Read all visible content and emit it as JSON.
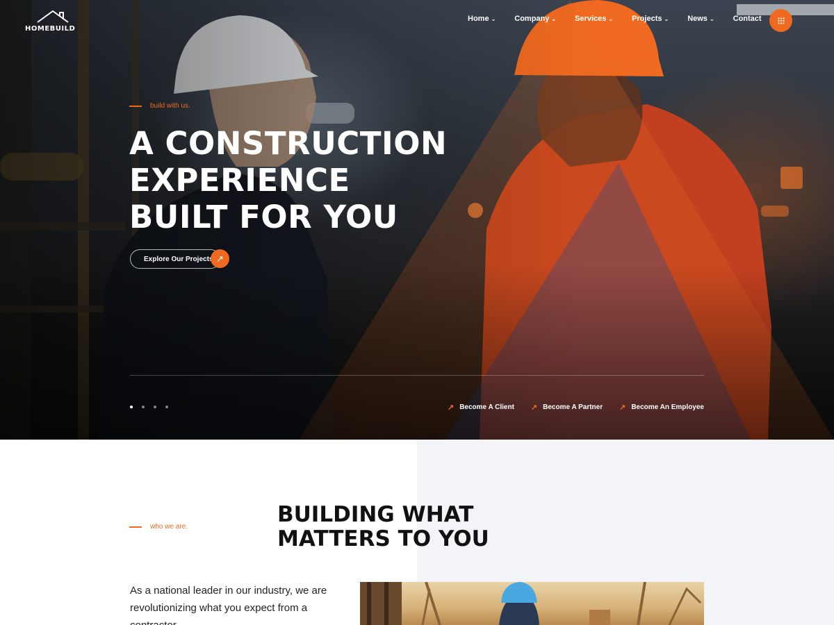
{
  "brand": {
    "name": "HOMEBUILD"
  },
  "nav": {
    "items": [
      {
        "label": "Home",
        "dropdown": true
      },
      {
        "label": "Company",
        "dropdown": true
      },
      {
        "label": "Services",
        "dropdown": true
      },
      {
        "label": "Projects",
        "dropdown": true
      },
      {
        "label": "News",
        "dropdown": true
      },
      {
        "label": "Contact",
        "dropdown": false
      }
    ],
    "menu_icon": "grid-icon"
  },
  "hero": {
    "eyebrow": "build with us.",
    "title_lines": [
      "A CONSTRUCTION",
      "EXPERIENCE",
      "BUILT FOR YOU"
    ],
    "cta_label": "Explore Our Projects",
    "cta_icon": "arrow-up-right-icon",
    "slides": {
      "count": 4,
      "active": 1
    },
    "quick_links": [
      {
        "label": "Become A Client",
        "icon": "arrow-up-right-icon"
      },
      {
        "label": "Become A Partner",
        "icon": "arrow-up-right-icon"
      },
      {
        "label": "Become An Employee",
        "icon": "arrow-up-right-icon"
      }
    ]
  },
  "about": {
    "eyebrow": "who we are.",
    "title_lines": [
      "BUILDING WHAT",
      "MATTERS TO YOU"
    ],
    "text": "As a national leader in our industry, we are revolutionizing what you expect from a contractor."
  },
  "colors": {
    "accent": "#ef6a20",
    "dark": "#1d1c1d",
    "light_panel": "#f2f4f8",
    "text": "#111111"
  }
}
